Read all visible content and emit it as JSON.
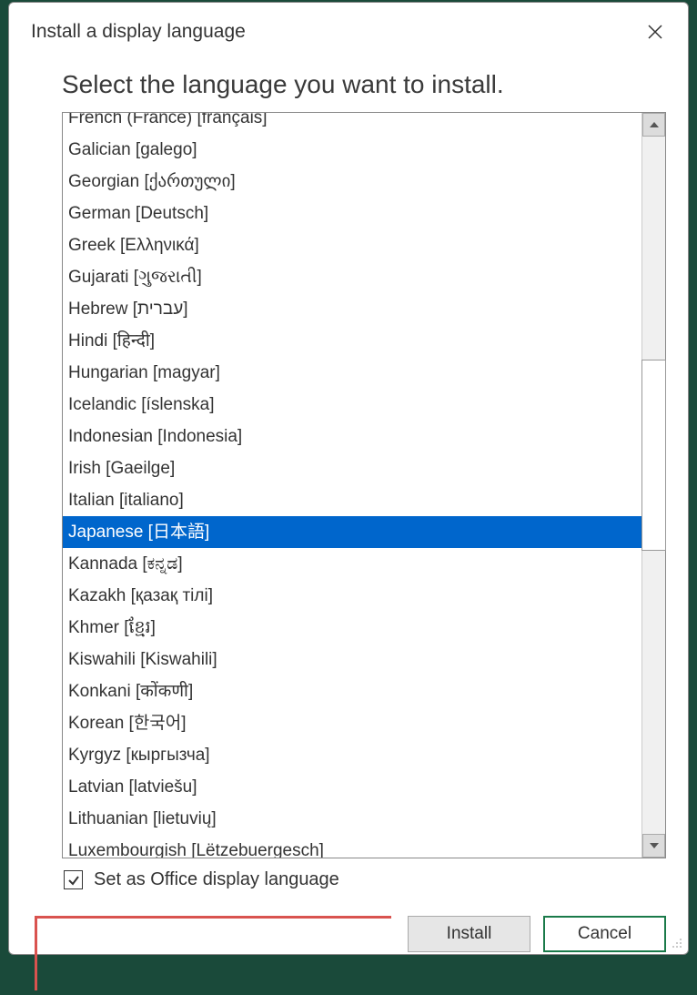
{
  "dialog": {
    "title": "Install a display language",
    "heading": "Select the language you want to install."
  },
  "languages": [
    "French (France) [français]",
    "Galician [galego]",
    "Georgian [ქართული]",
    "German [Deutsch]",
    "Greek [Ελληνικά]",
    "Gujarati [ગુજરાતી]",
    "Hebrew [עברית]",
    "Hindi [हिन्दी]",
    "Hungarian [magyar]",
    "Icelandic [íslenska]",
    "Indonesian [Indonesia]",
    "Irish [Gaeilge]",
    "Italian [italiano]",
    "Japanese [日本語]",
    "Kannada [ಕನ್ನಡ]",
    "Kazakh [қазақ тілі]",
    "Khmer [ខ្មែរ]",
    "Kiswahili [Kiswahili]",
    "Konkani [कोंकणी]",
    "Korean [한국어]",
    "Kyrgyz [кыргызча]",
    "Latvian [latviešu]",
    "Lithuanian [lietuvių]",
    "Luxembourgish [Lëtzebuergesch]"
  ],
  "selected_index": 13,
  "checkbox": {
    "label": "Set as Office display language",
    "checked": true
  },
  "buttons": {
    "install": "Install",
    "cancel": "Cancel"
  }
}
